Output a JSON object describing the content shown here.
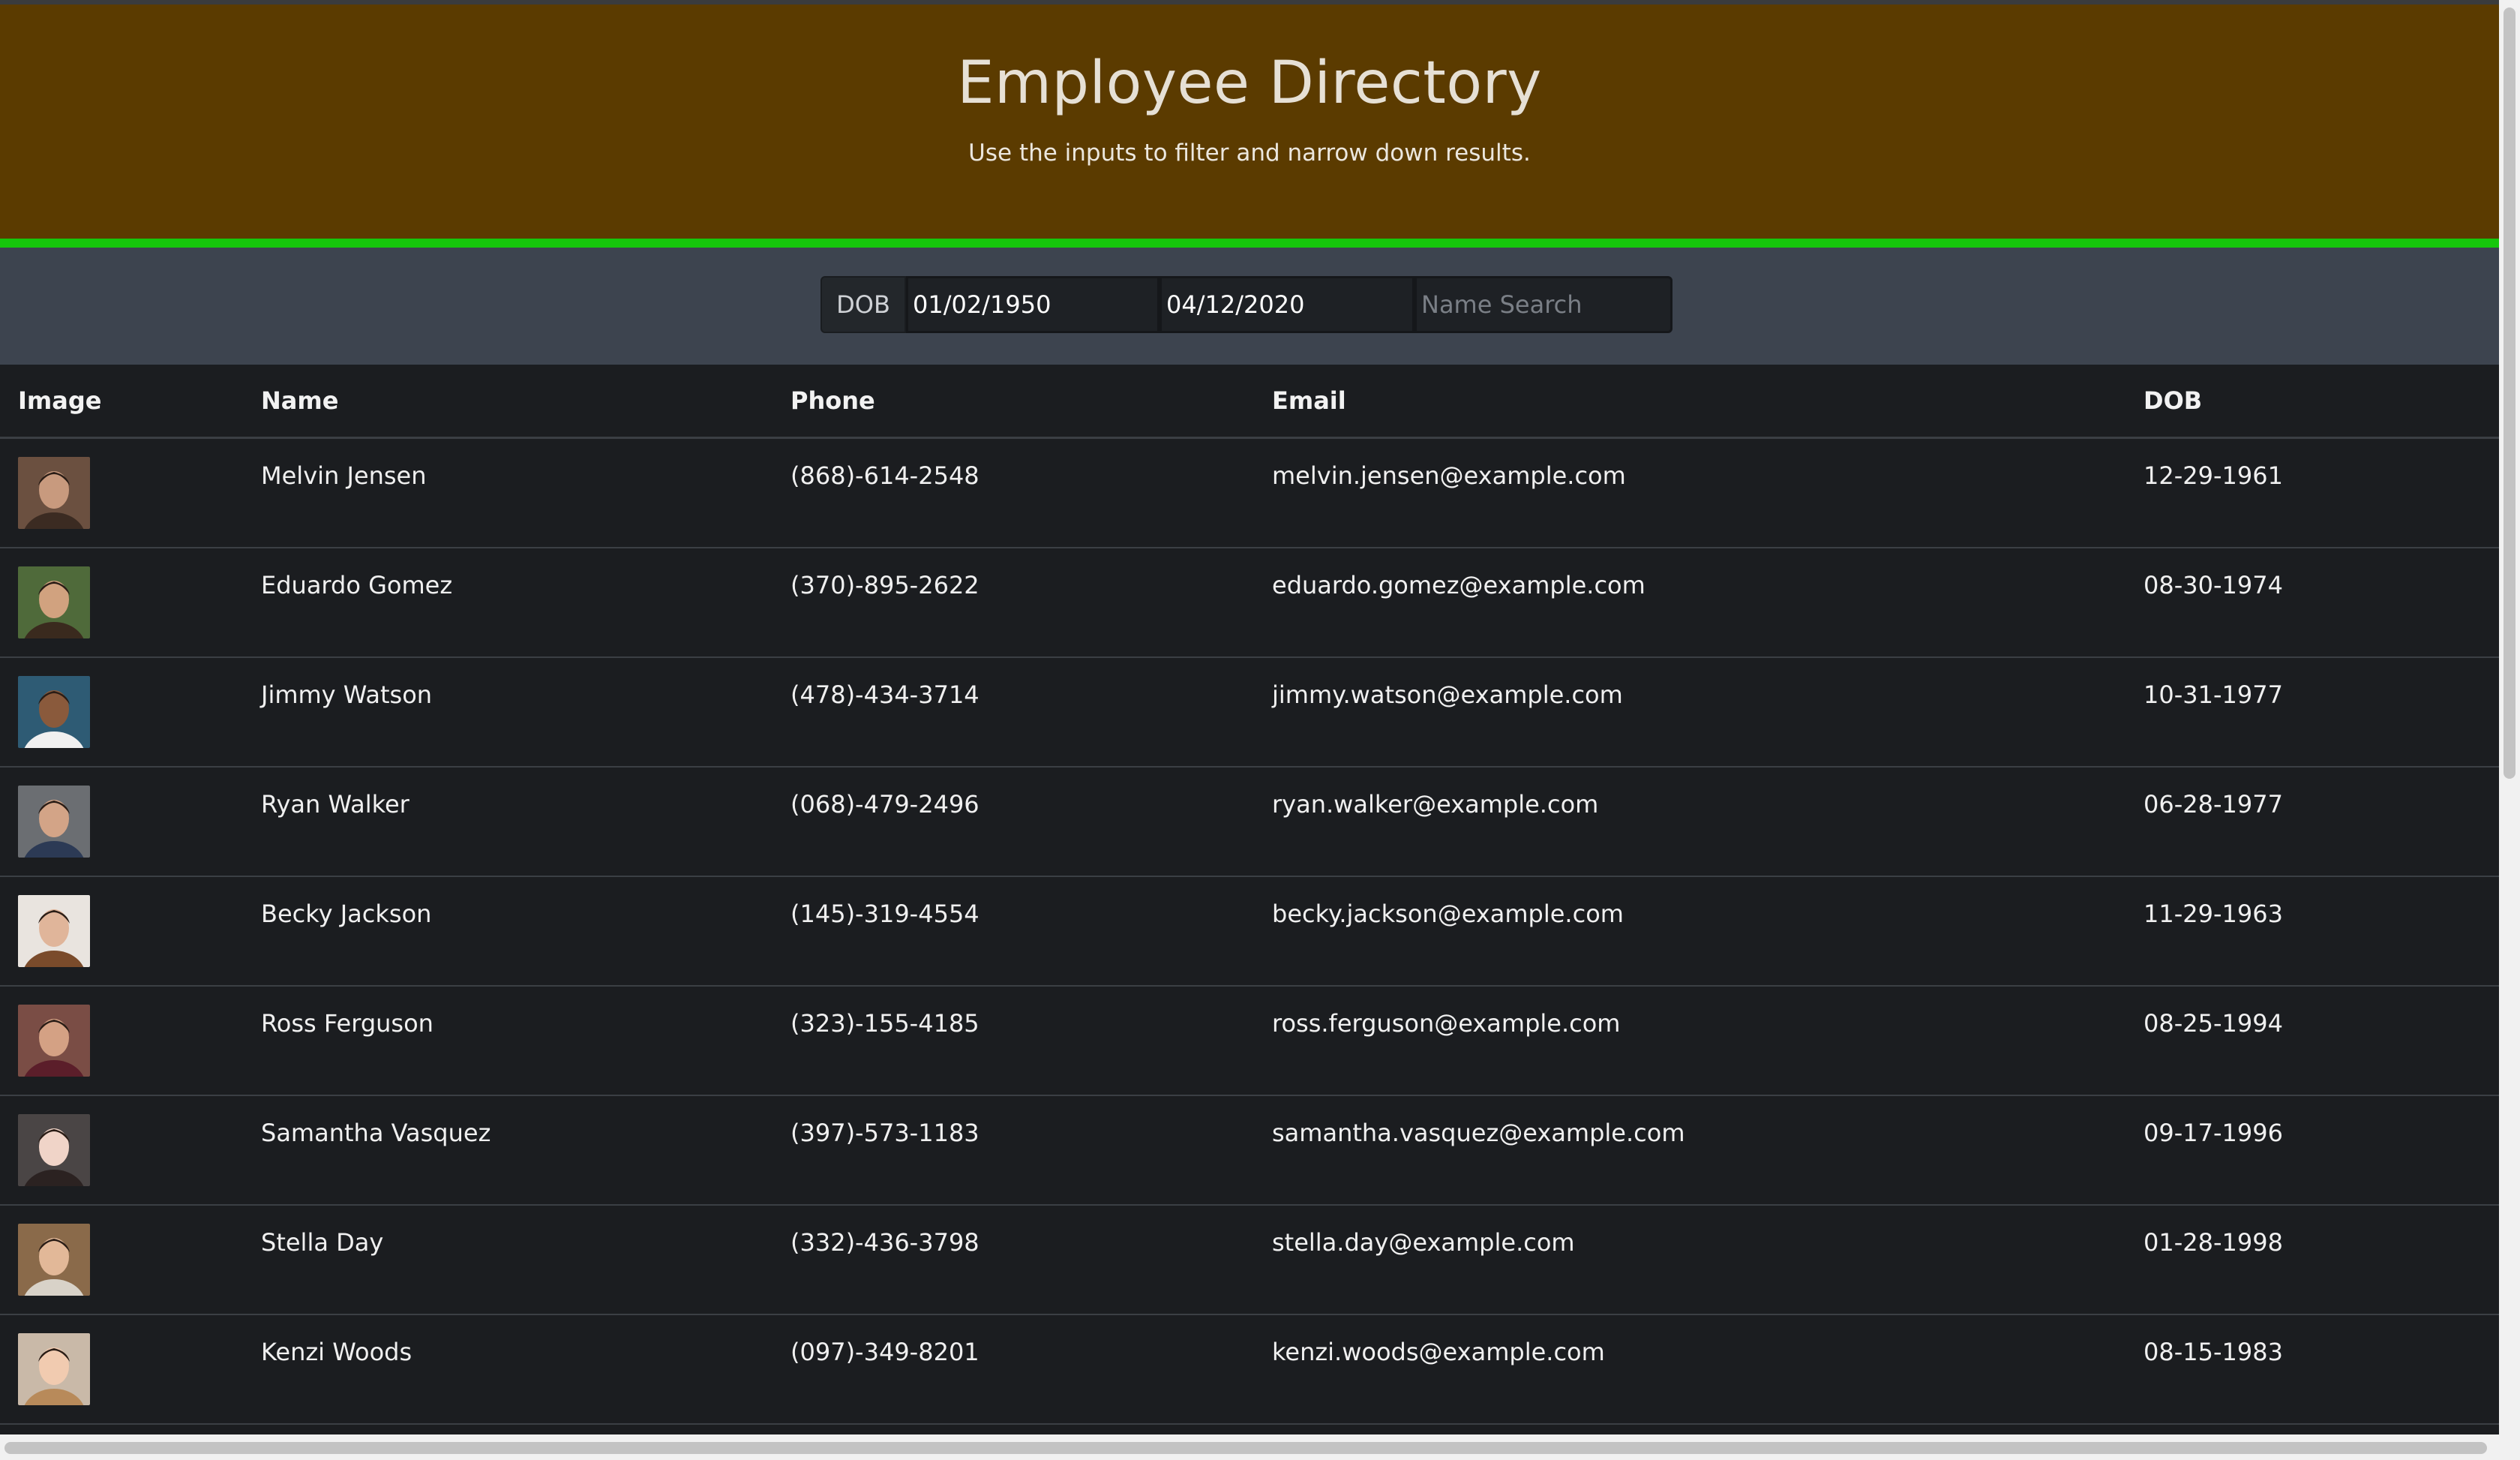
{
  "header": {
    "title": "Employee Directory",
    "subtitle": "Use the inputs to filter and narrow down results."
  },
  "filters": {
    "dob_label": "DOB",
    "dob_start": "01/02/1950",
    "dob_end": "04/12/2020",
    "name_placeholder": "Name Search"
  },
  "table": {
    "headers": [
      "Image",
      "Name",
      "Phone",
      "Email",
      "DOB"
    ],
    "rows": [
      {
        "name": "Melvin Jensen",
        "phone": "(868)-614-2548",
        "email": "melvin.jensen@example.com",
        "dob": "12-29-1961"
      },
      {
        "name": "Eduardo Gomez",
        "phone": "(370)-895-2622",
        "email": "eduardo.gomez@example.com",
        "dob": "08-30-1974"
      },
      {
        "name": "Jimmy Watson",
        "phone": "(478)-434-3714",
        "email": "jimmy.watson@example.com",
        "dob": "10-31-1977"
      },
      {
        "name": "Ryan Walker",
        "phone": "(068)-479-2496",
        "email": "ryan.walker@example.com",
        "dob": "06-28-1977"
      },
      {
        "name": "Becky Jackson",
        "phone": "(145)-319-4554",
        "email": "becky.jackson@example.com",
        "dob": "11-29-1963"
      },
      {
        "name": "Ross Ferguson",
        "phone": "(323)-155-4185",
        "email": "ross.ferguson@example.com",
        "dob": "08-25-1994"
      },
      {
        "name": "Samantha Vasquez",
        "phone": "(397)-573-1183",
        "email": "samantha.vasquez@example.com",
        "dob": "09-17-1996"
      },
      {
        "name": "Stella Day",
        "phone": "(332)-436-3798",
        "email": "stella.day@example.com",
        "dob": "01-28-1998"
      },
      {
        "name": "Kenzi Woods",
        "phone": "(097)-349-8201",
        "email": "kenzi.woods@example.com",
        "dob": "08-15-1983"
      }
    ]
  },
  "colors": {
    "header_bg": "#5b3b00",
    "accent_line": "#16c60c",
    "filter_bg": "#3d444f",
    "table_bg": "#1b1d20"
  }
}
